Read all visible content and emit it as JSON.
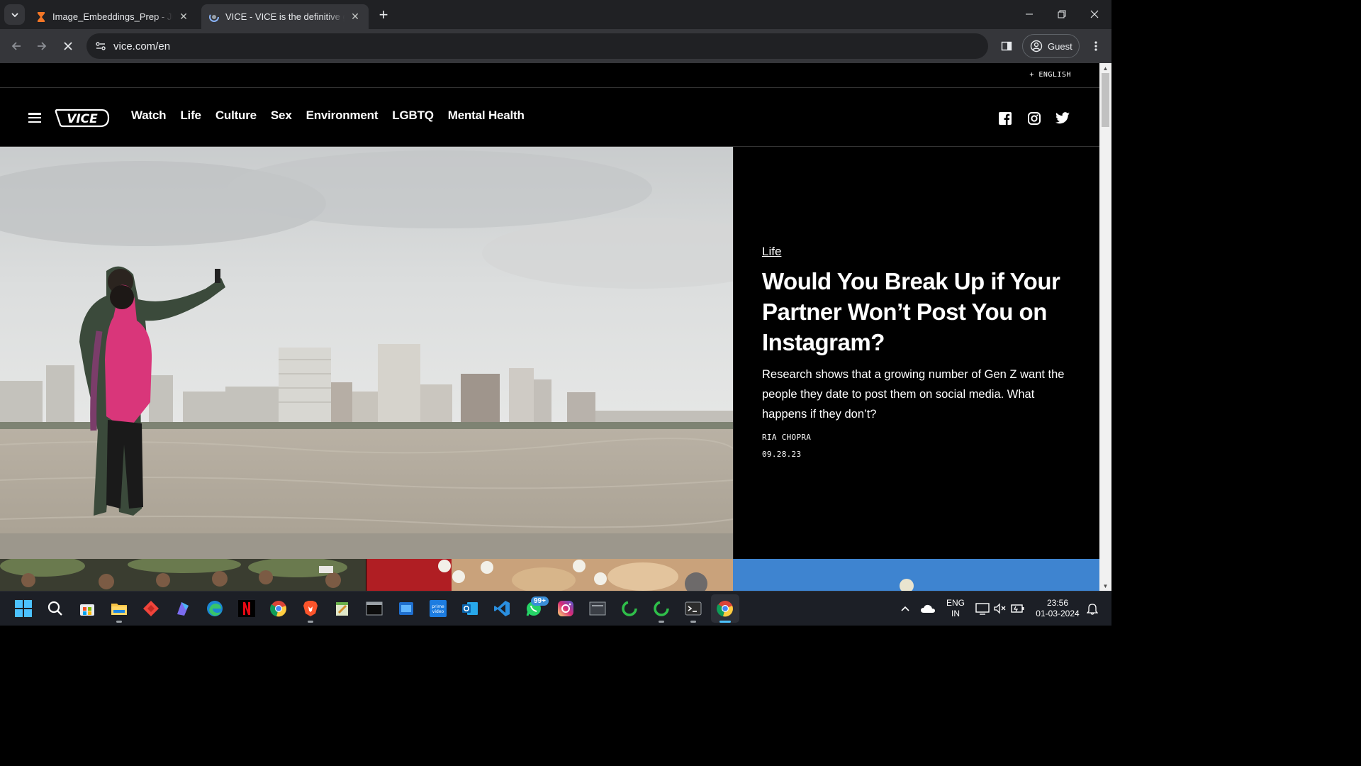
{
  "browser": {
    "tabs": [
      {
        "title": "Image_Embeddings_Prep - Jupyter",
        "active": false,
        "icon": "hourglass-icon"
      },
      {
        "title": "VICE - VICE is the definitive guide",
        "active": true,
        "icon": "vice-spinner-icon"
      }
    ],
    "url": "vice.com/en",
    "profile_label": "Guest",
    "accent": "#35363a"
  },
  "site": {
    "language": "+ ENGLISH",
    "logo": "VICE",
    "nav": [
      "Watch",
      "Life",
      "Culture",
      "Sex",
      "Environment",
      "LGBTQ",
      "Mental Health"
    ],
    "social": [
      "facebook-icon",
      "instagram-icon",
      "twitter-icon"
    ]
  },
  "feature": {
    "category": "Life",
    "headline": "Would You Break Up if Your Partner Won’t Post You on Instagram?",
    "dek": "Research shows that a growing number of Gen Z want the people they date to post them on social media. What happens if they don’t?",
    "author": "RIA CHOPRA",
    "date": "09.28.23"
  },
  "taskbar": {
    "apps": [
      "windows-start-icon",
      "search-icon",
      "store-icon",
      "file-explorer-icon",
      "anydesk-icon",
      "copilot-icon",
      "edge-icon",
      "netflix-icon",
      "chrome-icon",
      "brave-icon",
      "notepad-icon",
      "terminal-icon",
      "files-icon",
      "prime-video-icon",
      "outlook-icon",
      "vscode-icon",
      "whatsapp-icon",
      "instagram-icon",
      "window-icon",
      "circle-app-icon",
      "circle-app-2-icon",
      "terminal-2-icon",
      "chrome-active-icon"
    ],
    "whatsapp_badge": "99+",
    "lang_line1": "ENG",
    "lang_line2": "IN",
    "time": "23:56",
    "date": "01-03-2024"
  }
}
